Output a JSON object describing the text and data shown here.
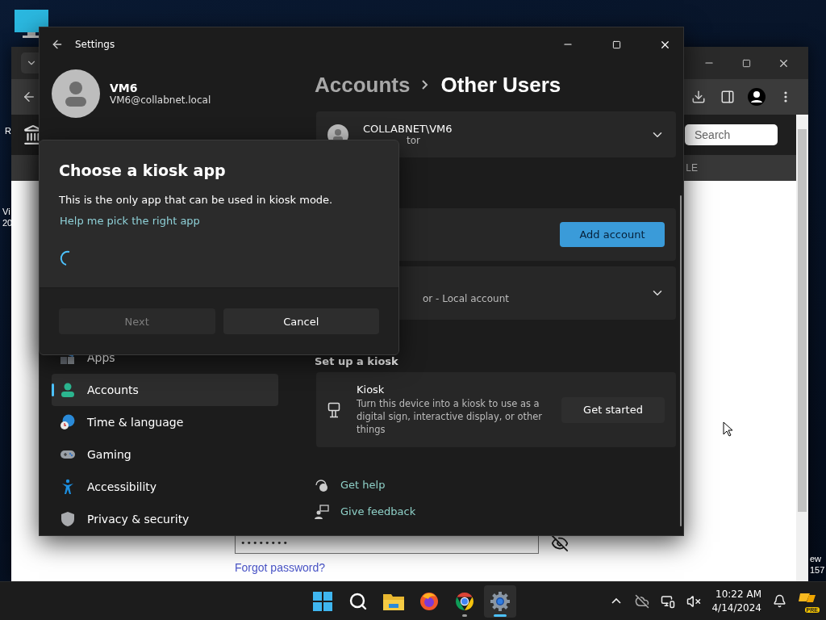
{
  "desktop": {
    "labels": [
      {
        "text": "R"
      },
      {
        "text": "Vi"
      },
      {
        "text": "20"
      },
      {
        "text": "ew"
      },
      {
        "text": "157"
      }
    ]
  },
  "browser": {
    "search": {
      "placeholder": "Search"
    },
    "nav_fragment": "LE",
    "password": {
      "value": "••••••••"
    },
    "forgot_link": "Forgot password?"
  },
  "settings": {
    "window": {
      "title": "Settings"
    },
    "user": {
      "name": "VM6",
      "email": "VM6@collabnet.local"
    },
    "breadcrumb": [
      "Accounts",
      "Other Users"
    ],
    "cards": [
      {
        "kind": "account",
        "name": "COLLABNET\\VM6",
        "detail": "tor",
        "expanded": false
      },
      {
        "kind": "add",
        "button": "Add account"
      },
      {
        "kind": "account",
        "detail": "or - Local account",
        "expanded": false
      }
    ],
    "kiosk": {
      "heading": "Set up a kiosk",
      "title": "Kiosk",
      "description": "Turn this device into a kiosk to use as a digital sign, interactive display, or other things",
      "button": "Get started"
    },
    "links": [
      {
        "kind": "help",
        "label": "Get help"
      },
      {
        "kind": "feedback",
        "label": "Give feedback"
      }
    ],
    "sidebar": {
      "items": [
        {
          "kind": "apps",
          "label": "Apps",
          "selected": false
        },
        {
          "kind": "accounts",
          "label": "Accounts",
          "selected": true
        },
        {
          "kind": "time",
          "label": "Time & language",
          "selected": false
        },
        {
          "kind": "gaming",
          "label": "Gaming",
          "selected": false
        },
        {
          "kind": "accessibility",
          "label": "Accessibility",
          "selected": false
        },
        {
          "kind": "privacy",
          "label": "Privacy & security",
          "selected": false
        }
      ]
    }
  },
  "dialog": {
    "title": "Choose a kiosk app",
    "text": "This is the only app that can be used in kiosk mode.",
    "link": "Help me pick the right app",
    "loading": true,
    "buttons": [
      {
        "label": "Next",
        "disabled": true
      },
      {
        "label": "Cancel",
        "disabled": false
      }
    ]
  },
  "taskbar": {
    "apps": [
      {
        "kind": "start",
        "active": false,
        "running": false
      },
      {
        "kind": "search",
        "active": false,
        "running": false
      },
      {
        "kind": "explorer",
        "active": false,
        "running": false
      },
      {
        "kind": "firefox",
        "active": false,
        "running": false
      },
      {
        "kind": "chrome",
        "active": false,
        "running": true
      },
      {
        "kind": "settings",
        "active": true,
        "running": true
      }
    ],
    "clock": {
      "time": "10:22 AM",
      "date": "4/14/2024"
    },
    "badge": "PRE"
  }
}
